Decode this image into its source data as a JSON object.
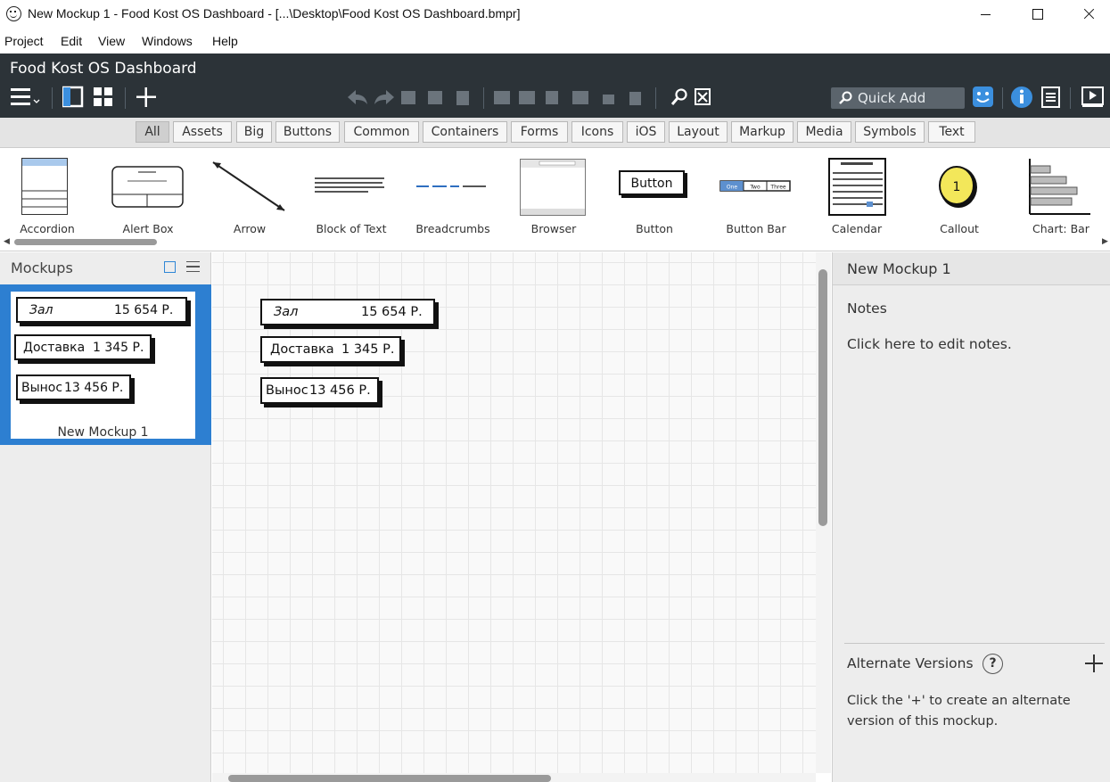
{
  "window": {
    "title": "New Mockup 1 - Food Kost OS Dashboard - [...\\Desktop\\Food Kost OS Dashboard.bmpr]"
  },
  "menu": [
    "Project",
    "Edit",
    "View",
    "Windows",
    "Help"
  ],
  "app": {
    "title": "Food Kost OS Dashboard",
    "quick_add_label": "Quick Add"
  },
  "filters": {
    "active": "All",
    "tabs": [
      "All",
      "Assets",
      "Big",
      "Buttons",
      "Common",
      "Containers",
      "Forms",
      "Icons",
      "iOS",
      "Layout",
      "Markup",
      "Media",
      "Symbols",
      "Text"
    ]
  },
  "library": {
    "items": [
      "Accordion",
      "Alert Box",
      "Arrow",
      "Block of Text",
      "Breadcrumbs",
      "Browser",
      "Button",
      "Button Bar",
      "Calendar",
      "Callout",
      "Chart: Bar"
    ],
    "thumb_text": {
      "button": "Button",
      "button_bar": [
        "One",
        "Two",
        "Three"
      ],
      "callout": "1"
    }
  },
  "mockups_panel": {
    "title": "Mockups",
    "items": [
      {
        "name": "New Mockup 1",
        "selected": true
      }
    ]
  },
  "canvas": {
    "widgets": [
      {
        "label": "Зал",
        "value": "15 654 Р."
      },
      {
        "label": "Доставка",
        "value": "1 345 Р."
      },
      {
        "label": "Вынос",
        "value": "13 456 Р."
      }
    ]
  },
  "properties": {
    "mockup_name": "New Mockup 1",
    "notes_label": "Notes",
    "notes_placeholder": "Click here to edit notes.",
    "alt_versions_title": "Alternate Versions",
    "alt_help_symbol": "?",
    "alt_versions_help": "Click the '+' to create an alternate version of this mockup."
  },
  "colors": {
    "header_bg": "#2c3338",
    "selection_blue": "#2d7fd1",
    "canvas_bg": "#f9f9f9"
  }
}
